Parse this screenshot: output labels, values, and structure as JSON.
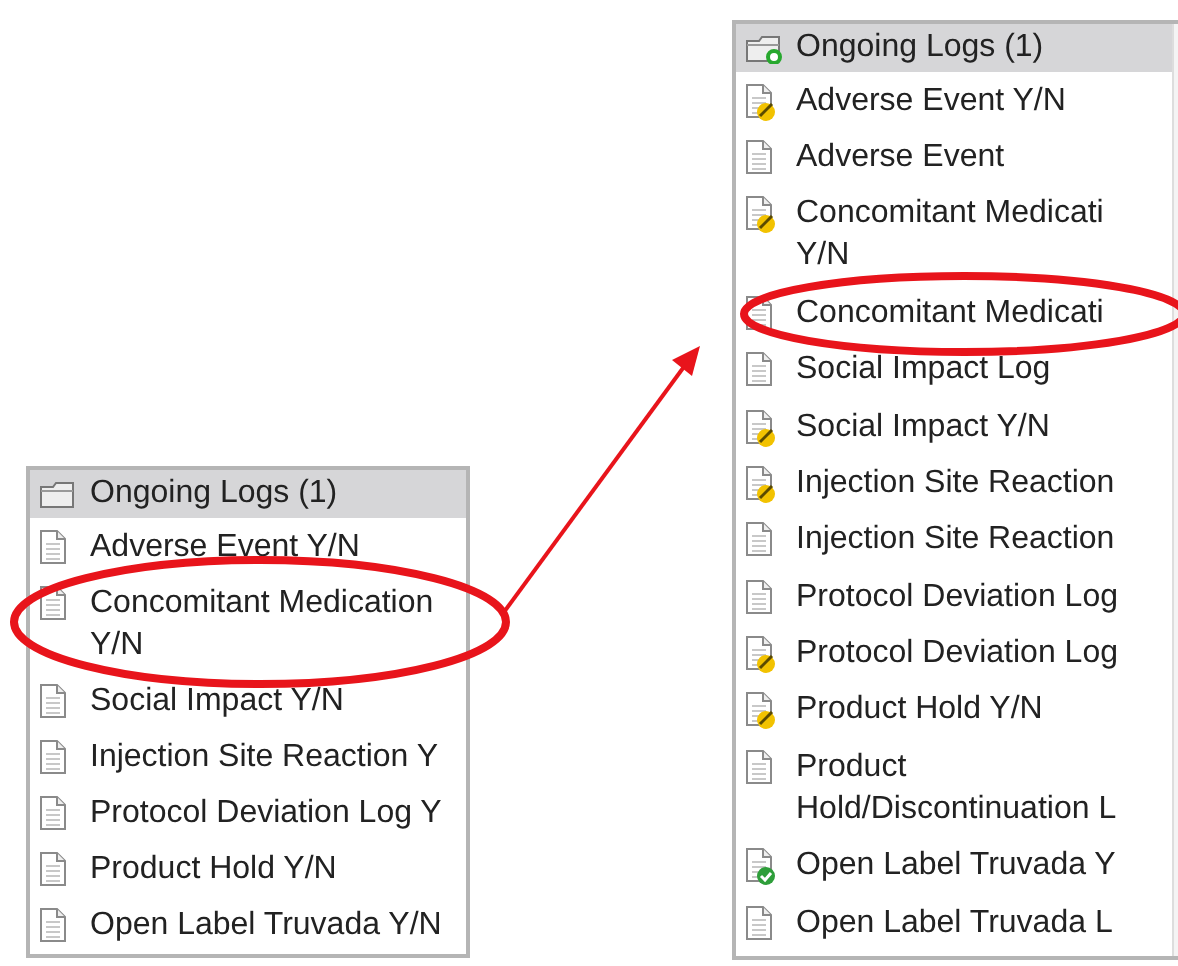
{
  "panels": [
    {
      "header": {
        "title": "Ongoing Logs (1)",
        "kind": "folder"
      },
      "items": [
        {
          "text": "Adverse Event Y/N",
          "kind": "blank"
        },
        {
          "text": "Concomitant Medication\nY/N",
          "kind": "blank"
        },
        {
          "text": "Social Impact Y/N",
          "kind": "blank"
        },
        {
          "text": "Injection Site Reaction Y",
          "kind": "blank"
        },
        {
          "text": "Protocol Deviation Log Y",
          "kind": "blank"
        },
        {
          "text": "Product Hold Y/N",
          "kind": "blank"
        },
        {
          "text": "Open Label Truvada Y/N",
          "kind": "blank"
        }
      ]
    },
    {
      "header": {
        "title": "Ongoing Logs (1)",
        "kind": "folder-new"
      },
      "items": [
        {
          "text": "Adverse Event Y/N",
          "kind": "pencil"
        },
        {
          "text": "Adverse Event",
          "kind": "blank"
        },
        {
          "text": "Concomitant Medicati\nY/N",
          "kind": "pencil"
        },
        {
          "text": "Concomitant Medicati",
          "kind": "blank"
        },
        {
          "text": "Social Impact Log",
          "kind": "blank"
        },
        {
          "text": "Social Impact Y/N",
          "kind": "pencil"
        },
        {
          "text": "Injection Site Reaction",
          "kind": "pencil"
        },
        {
          "text": "Injection Site Reaction",
          "kind": "blank"
        },
        {
          "text": "Protocol Deviation Log",
          "kind": "blank"
        },
        {
          "text": "Protocol Deviation Log",
          "kind": "pencil"
        },
        {
          "text": "Product Hold Y/N",
          "kind": "pencil"
        },
        {
          "text": "Product\nHold/Discontinuation L",
          "kind": "blank"
        },
        {
          "text": "Open Label Truvada Y",
          "kind": "check"
        },
        {
          "text": "Open Label Truvada L",
          "kind": "blank"
        }
      ]
    }
  ]
}
